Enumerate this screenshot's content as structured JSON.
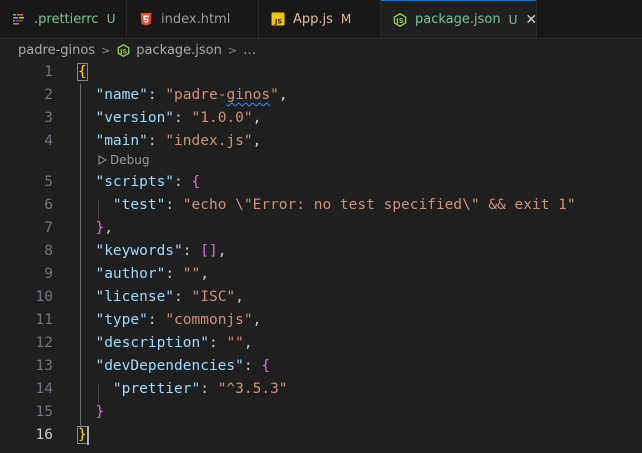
{
  "tabs": [
    {
      "label": ".prettierrc",
      "status": "U",
      "icon": "prettier-icon",
      "active": false
    },
    {
      "label": "index.html",
      "status": "",
      "icon": "html5-icon",
      "active": false
    },
    {
      "label": "App.js",
      "status": "M",
      "icon": "javascript-icon",
      "active": false
    },
    {
      "label": "package.json",
      "status": "U",
      "icon": "nodejs-icon",
      "active": true,
      "close": "✕"
    }
  ],
  "breadcrumb": {
    "folder": "padre-ginos",
    "file": "package.json",
    "more": "…",
    "separator": ">"
  },
  "codelens": {
    "label": "Debug",
    "icon": "play-outline-icon"
  },
  "editor": {
    "line_numbers": [
      "1",
      "2",
      "3",
      "4",
      "5",
      "6",
      "7",
      "8",
      "9",
      "10",
      "11",
      "12",
      "13",
      "14",
      "15",
      "16"
    ],
    "current_line": 16,
    "lines": {
      "l1": {
        "open": "{"
      },
      "l2": {
        "key": "\"name\"",
        "colon": ": ",
        "value_a": "\"padre-",
        "value_b": "ginos",
        "value_c": "\"",
        "comma": ","
      },
      "l3": {
        "key": "\"version\"",
        "colon": ": ",
        "value": "\"1.0.0\"",
        "comma": ","
      },
      "l4": {
        "key": "\"main\"",
        "colon": ": ",
        "value": "\"index.js\"",
        "comma": ","
      },
      "l5": {
        "key": "\"scripts\"",
        "colon": ": ",
        "open": "{"
      },
      "l6": {
        "key": "\"test\"",
        "colon": ": ",
        "value": "\"echo \\\"Error: no test specified\\\" && exit 1\""
      },
      "l7": {
        "close": "}",
        "comma": ","
      },
      "l8": {
        "key": "\"keywords\"",
        "colon": ": ",
        "open": "[",
        "close": "]",
        "comma": ","
      },
      "l9": {
        "key": "\"author\"",
        "colon": ": ",
        "value": "\"\"",
        "comma": ","
      },
      "l10": {
        "key": "\"license\"",
        "colon": ": ",
        "value": "\"ISC\"",
        "comma": ","
      },
      "l11": {
        "key": "\"type\"",
        "colon": ": ",
        "value": "\"commonjs\"",
        "comma": ","
      },
      "l12": {
        "key": "\"description\"",
        "colon": ": ",
        "value": "\"\"",
        "comma": ","
      },
      "l13": {
        "key": "\"devDependencies\"",
        "colon": ": ",
        "open": "{"
      },
      "l14": {
        "key": "\"prettier\"",
        "colon": ": ",
        "value": "\"^3.5.3\""
      },
      "l15": {
        "close": "}"
      },
      "l16": {
        "close": "}"
      }
    }
  },
  "colors": {
    "background": "#1f1f1f",
    "tab_bar": "#181818",
    "json_key": "#9cdcfe",
    "json_string": "#ce9178",
    "brace_level_1": "#ffd700",
    "brace_level_2": "#da70d6",
    "bracket_level_3": "#179fff",
    "git_untracked": "#73c991",
    "git_modified": "#e2c08d",
    "active_tab_border": "#0078d4"
  }
}
